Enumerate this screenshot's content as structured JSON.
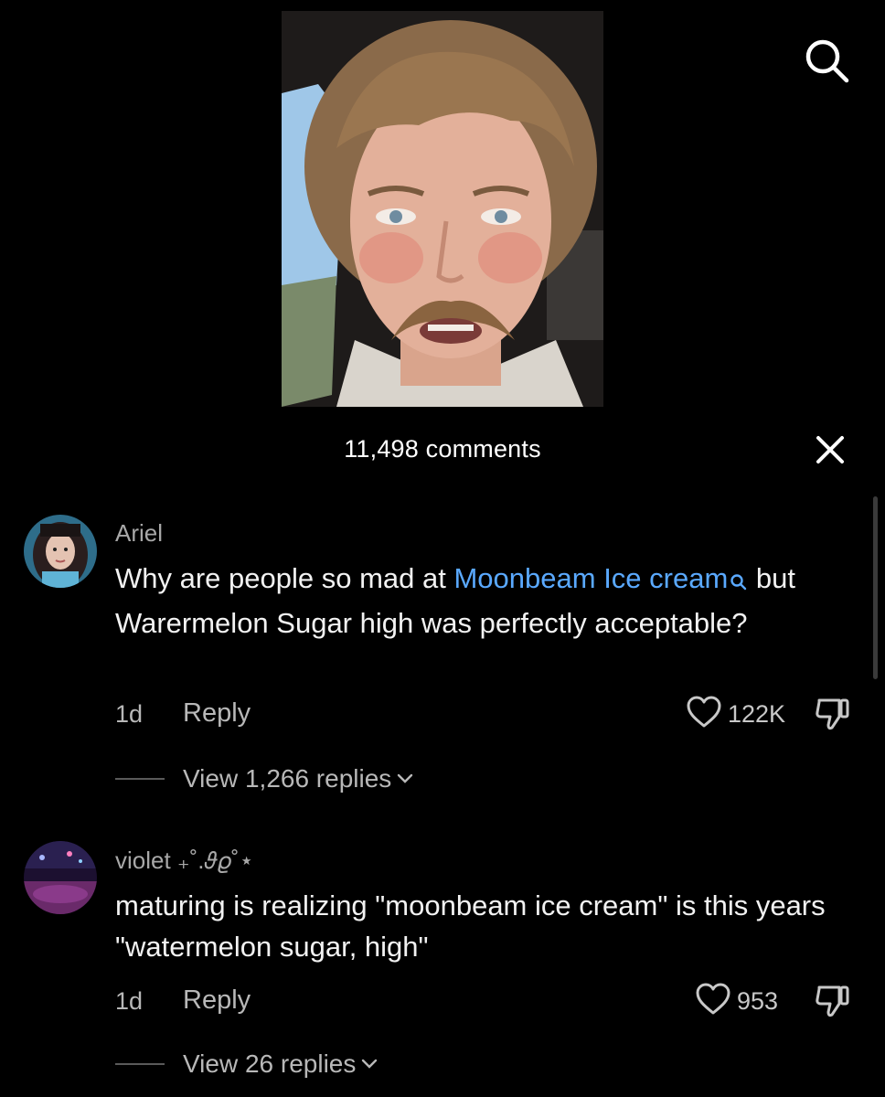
{
  "top": {
    "search_icon": "search-icon"
  },
  "comments_header": {
    "count_label": "11,498 comments",
    "close_icon": "close-icon"
  },
  "comments": [
    {
      "username": "Ariel",
      "text_before": "Why are people so mad at ",
      "mention": "Moonbeam Ice cream",
      "text_after": " but Warermelon Sugar high was perfectly acceptable?",
      "time": "1d",
      "reply_label": "Reply",
      "likes": "122K",
      "view_replies": "View 1,266 replies"
    },
    {
      "username": "violet ₊˚.𝜗𝜚˚⋆",
      "text": "maturing is realizing \"moonbeam ice cream\" is this years \"watermelon sugar, high\"",
      "time": "1d",
      "reply_label": "Reply",
      "likes": "953",
      "view_replies": "View 26 replies"
    }
  ],
  "colors": {
    "background": "#000000",
    "mention": "#5aa9ff",
    "secondary_text": "#a8a8a8"
  }
}
